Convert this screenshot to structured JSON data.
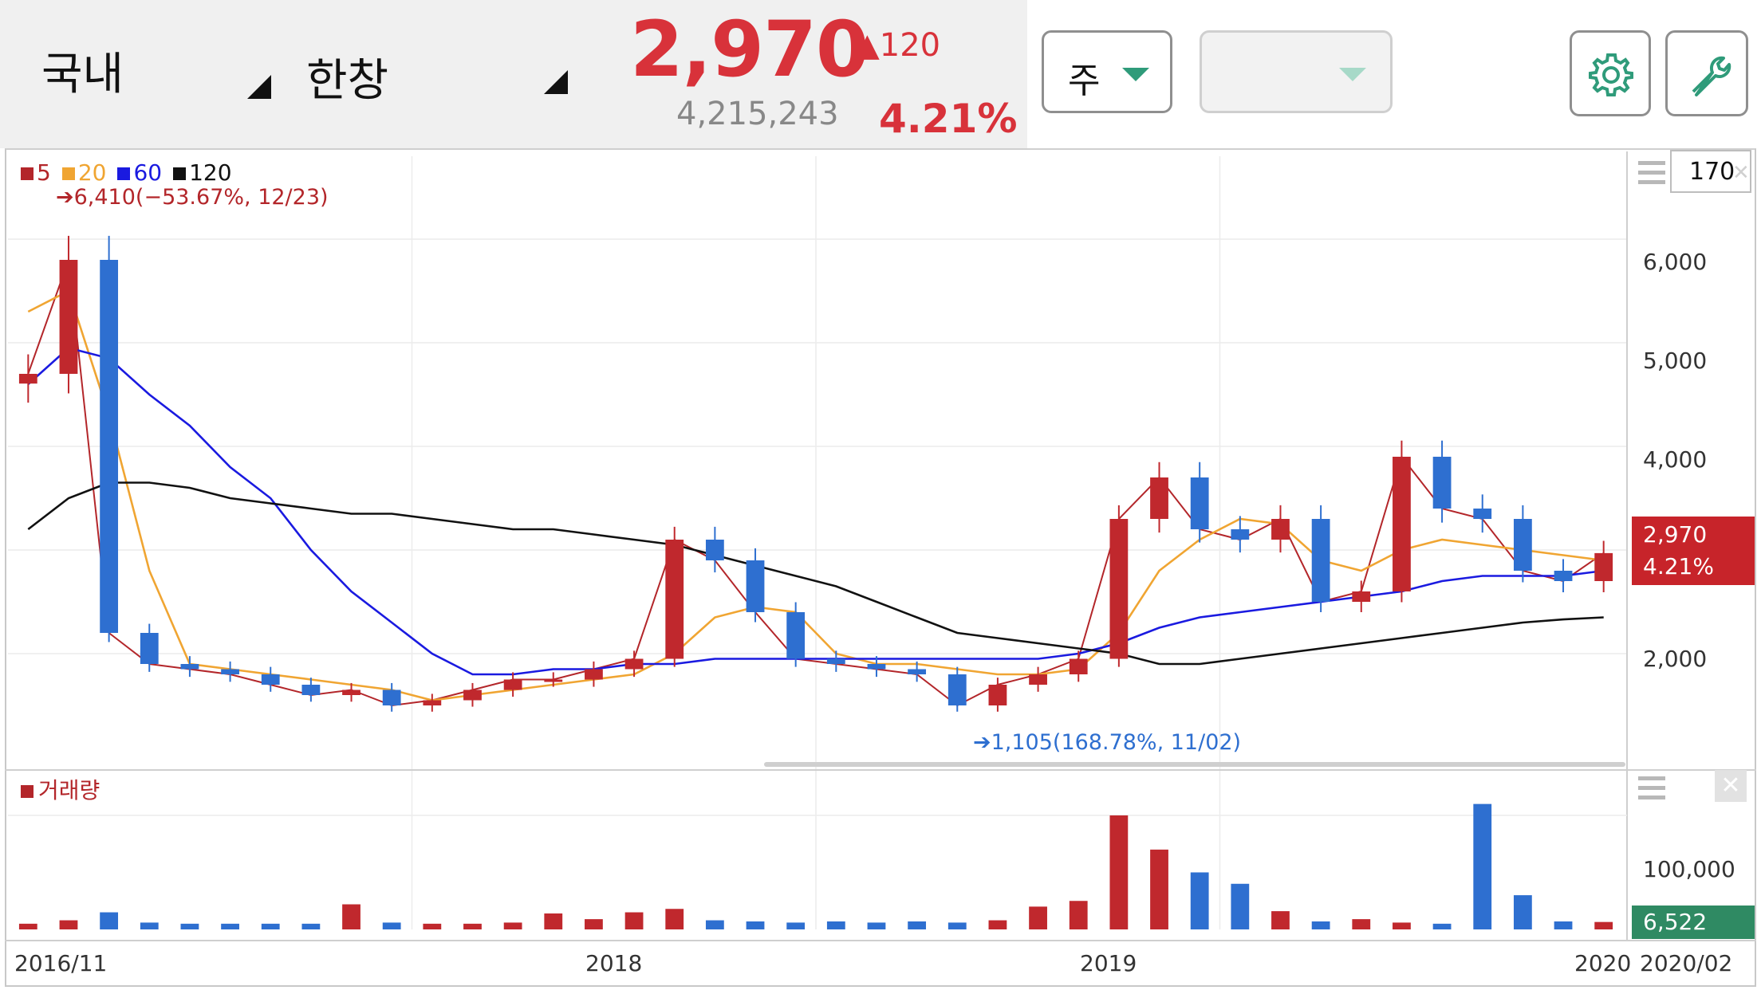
{
  "header": {
    "market_label": "국내",
    "stock_name": "한창",
    "price": "2,970",
    "change": "▲120",
    "volume": "4,215,243",
    "change_pct": "4.21%",
    "period_select": "주",
    "second_select": ""
  },
  "toolbar": {
    "settings_icon": "gear-icon",
    "tools_icon": "wrench-icon",
    "count_value": "170"
  },
  "colors": {
    "up": "#c0282d",
    "down": "#2e6fd0",
    "ma5": "#b3262a",
    "ma20": "#f0a532",
    "ma60": "#1a1ae0",
    "ma120": "#111111",
    "accent_green": "#2f9b7a"
  },
  "price_panel": {
    "legend": [
      {
        "label": "5",
        "color": "#b3262a"
      },
      {
        "label": "20",
        "color": "#f0a532"
      },
      {
        "label": "60",
        "color": "#1a1ae0"
      },
      {
        "label": "120",
        "color": "#111111"
      }
    ],
    "max_annotation": "➔6,410(−53.67%, 12/23)",
    "min_annotation": "➔1,105(168.78%, 11/02)",
    "y_ticks": [
      "6,000",
      "5,000",
      "4,000",
      "2,000"
    ],
    "price_tag": "2,970",
    "pct_tag": "4.21%"
  },
  "volume_panel": {
    "title": "거래량",
    "y_ticks": [
      "100,000"
    ],
    "last_tag": "6,522"
  },
  "x_axis": {
    "labels": [
      "2016/11",
      "2018",
      "2019",
      "2020",
      "2020/02"
    ]
  },
  "chart_data": {
    "type": "line",
    "x": [
      "2016/11",
      "2016/12",
      "2017/01",
      "2017/02",
      "2017/03",
      "2017/04",
      "2017/05",
      "2017/06",
      "2017/07",
      "2017/08",
      "2017/09",
      "2017/10",
      "2017/11",
      "2017/12",
      "2018/01",
      "2018/02",
      "2018/03",
      "2018/04",
      "2018/05",
      "2018/06",
      "2018/07",
      "2018/08",
      "2018/09",
      "2018/10",
      "2018/11",
      "2018/12",
      "2019/01",
      "2019/02",
      "2019/03",
      "2019/04",
      "2019/05",
      "2019/06",
      "2019/07",
      "2019/08",
      "2019/09",
      "2019/10",
      "2019/11",
      "2019/12",
      "2020/01",
      "2020/02"
    ],
    "series": [
      {
        "name": "5",
        "values": [
          4700,
          5800,
          2200,
          1900,
          1850,
          1800,
          1700,
          1600,
          1650,
          1500,
          1550,
          1650,
          1750,
          1750,
          1850,
          1950,
          3100,
          2900,
          2400,
          1950,
          1900,
          1850,
          1800,
          1500,
          1700,
          1800,
          1950,
          3300,
          3700,
          3200,
          3100,
          3300,
          2500,
          2600,
          3900,
          3400,
          3300,
          2800,
          2700,
          2970
        ]
      },
      {
        "name": "20",
        "values": [
          5300,
          5500,
          4300,
          2800,
          1900,
          1850,
          1800,
          1750,
          1700,
          1650,
          1550,
          1600,
          1650,
          1700,
          1750,
          1800,
          2000,
          2350,
          2450,
          2400,
          2000,
          1900,
          1900,
          1850,
          1800,
          1800,
          1850,
          2200,
          2800,
          3100,
          3300,
          3250,
          2900,
          2800,
          3000,
          3100,
          3050,
          3000,
          2950,
          2900
        ]
      },
      {
        "name": "60",
        "values": [
          4600,
          4950,
          4850,
          4500,
          4200,
          3800,
          3500,
          3000,
          2600,
          2300,
          2000,
          1800,
          1800,
          1850,
          1850,
          1900,
          1900,
          1950,
          1950,
          1950,
          1950,
          1950,
          1950,
          1950,
          1950,
          1950,
          2000,
          2100,
          2250,
          2350,
          2400,
          2450,
          2500,
          2550,
          2600,
          2700,
          2750,
          2750,
          2750,
          2800
        ]
      },
      {
        "name": "120",
        "values": [
          3200,
          3500,
          3650,
          3650,
          3600,
          3500,
          3450,
          3400,
          3350,
          3350,
          3300,
          3250,
          3200,
          3200,
          3150,
          3100,
          3050,
          2950,
          2850,
          2750,
          2650,
          2500,
          2350,
          2200,
          2150,
          2100,
          2050,
          2000,
          1900,
          1900,
          1950,
          2000,
          2050,
          2100,
          2150,
          2200,
          2250,
          2300,
          2330,
          2350
        ]
      }
    ],
    "volume": [
      5000,
      8000,
      15000,
      6000,
      5000,
      5000,
      5000,
      5000,
      22000,
      6000,
      5000,
      5000,
      6000,
      14000,
      9000,
      15000,
      18000,
      8000,
      7000,
      6000,
      7000,
      6000,
      7000,
      6000,
      8000,
      20000,
      25000,
      100000,
      70000,
      50000,
      40000,
      16000,
      7000,
      9000,
      6000,
      5000,
      110000,
      30000,
      7000,
      6522
    ],
    "ylabel": "",
    "ylim": [
      1000,
      6800
    ],
    "volume_ylim": [
      0,
      130000
    ],
    "grid": true,
    "legend_position": "top-left"
  }
}
